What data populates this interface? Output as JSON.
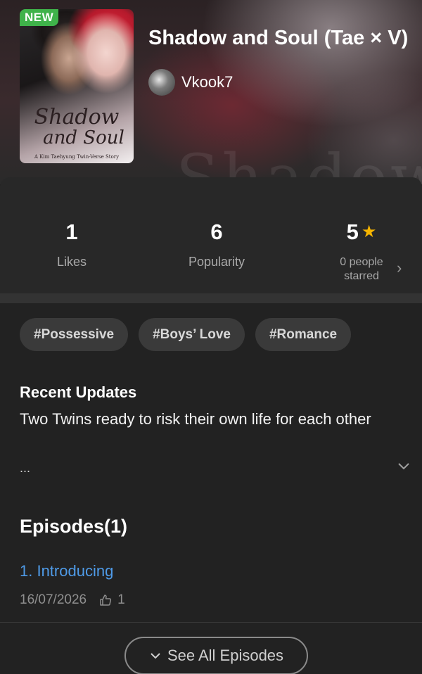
{
  "cover": {
    "badge": "NEW",
    "title_line1": "Shadow",
    "title_line2": "and Soul",
    "subtitle": "A Kim Taehyung Twin-Verse Story"
  },
  "story": {
    "title": "Shadow and Soul (Tae × V)",
    "author": "Vkook7",
    "watermark": "Shadow"
  },
  "stats": {
    "likes_value": "1",
    "likes_label": "Likes",
    "popularity_value": "6",
    "popularity_label": "Popularity",
    "rating_value": "5",
    "rating_label_line1": "0 people",
    "rating_label_line2": "starred"
  },
  "tags": [
    "#Possessive",
    "#Boys’ Love",
    "#Romance"
  ],
  "recent_updates": {
    "title": "Recent Updates",
    "text": "Two Twins ready to risk their own life for each other",
    "ellipsis": "..."
  },
  "episodes": {
    "title": "Episodes(1)",
    "items": [
      {
        "label": "1. Introducing",
        "date": "16/07/2026",
        "likes": "1"
      }
    ],
    "see_all": "See All Episodes"
  },
  "colors": {
    "background": "#222222",
    "card": "#282828",
    "accent_link": "#4f9be8",
    "star": "#f6b500",
    "badge_new": "#3fb24a"
  },
  "icons": [
    "star-icon",
    "chevron-right-icon",
    "chevron-down-icon",
    "thumbs-up-icon"
  ]
}
